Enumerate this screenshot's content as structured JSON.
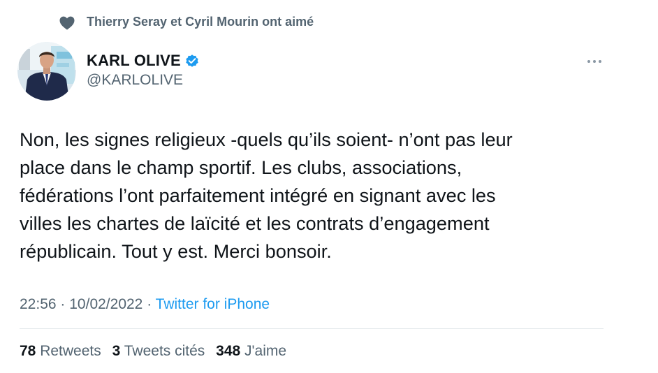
{
  "social_context": {
    "icon": "heart-icon",
    "text": "Thierry Seray et Cyril Mourin ont aimé"
  },
  "author": {
    "display_name": "KARL OLIVE",
    "handle": "@KARLOLIVE",
    "verified_icon": "verified-badge-icon",
    "avatar_icon": "avatar"
  },
  "tweet": {
    "text": "Non, les signes religieux -quels qu’ils soient- n’ont pas leur\nplace dans le champ sportif. Les clubs, associations,\nfédérations l’ont parfaitement intégré en signant avec les\nvilles les chartes de laïcité et les contrats d’engagement\nrépublicain. Tout y est. Merci bonsoir.",
    "time": "22:56",
    "separator": "·",
    "date": "10/02/2022",
    "source": "Twitter for iPhone"
  },
  "stats": {
    "retweets_count": "78",
    "retweets_label": "Retweets",
    "quotes_count": "3",
    "quotes_label": "Tweets cités",
    "likes_count": "348",
    "likes_label": "J'aime"
  },
  "colors": {
    "text_primary": "#0f1419",
    "text_secondary": "#536471",
    "link": "#1d9bf0",
    "verified": "#1d9bf0",
    "heart": "#536471"
  }
}
